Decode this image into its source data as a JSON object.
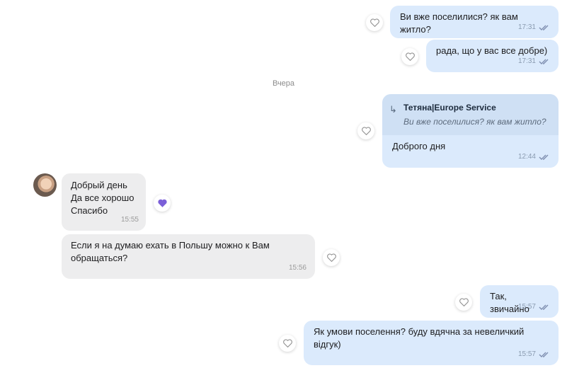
{
  "date_divider": "Вчера",
  "messages": [
    {
      "text": "Ви вже поселилися? як вам житло?",
      "time": "17:31"
    },
    {
      "text": "рада, що у вас все добре)",
      "time": "17:31"
    },
    {
      "reply_author": "Тетяна|Europe Service",
      "reply_text": "Ви вже поселилися? як вам житло?",
      "text": "Доброго дня",
      "time": "12:44"
    },
    {
      "text": "Добрый день\nДа все хорошо\nСпасибо",
      "time": "15:55"
    },
    {
      "text": "Если я на думаю ехать в Польшу можно к Вам\nобращаться?",
      "time": "15:56"
    },
    {
      "text": "Так, звичайно",
      "time": "15:57"
    },
    {
      "text": "Як умови поселення? буду вдячна за невеличкий\nвідгук)",
      "time": "15:57"
    }
  ],
  "colors": {
    "outgoing_bubble": "#dbeafc",
    "incoming_bubble": "#ededee",
    "reply_header": "#cfe0f4",
    "reaction_heart_filled": "#7b5fd8",
    "read_ticks": "#7f8fb0"
  },
  "icons": {
    "reaction": "heart-icon",
    "read": "double-check-icon",
    "reply": "reply-arrow-icon"
  }
}
